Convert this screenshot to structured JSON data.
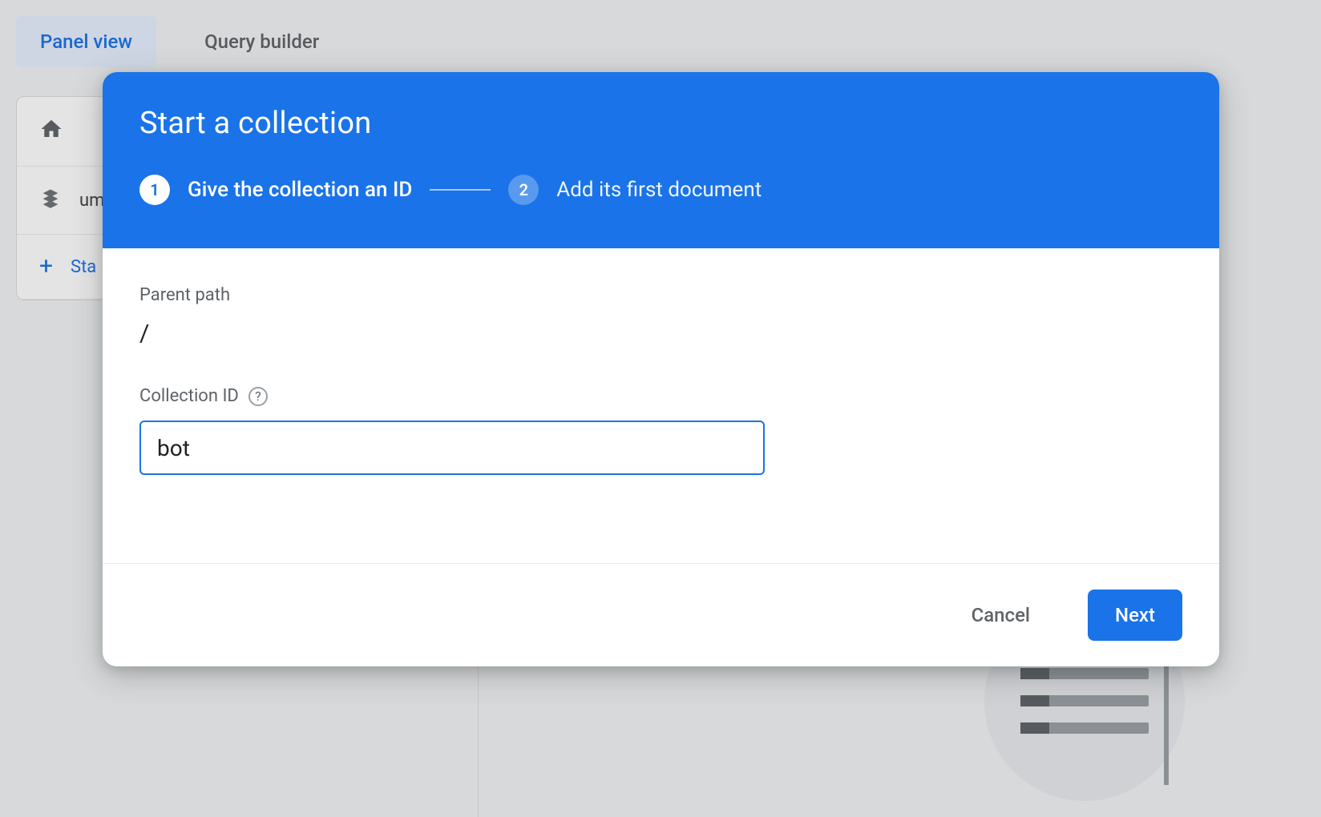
{
  "backdrop": {
    "tabs": {
      "panel_view": "Panel view",
      "query_builder": "Query builder"
    },
    "sidebar": {
      "item_text": "um",
      "start_text": "Sta"
    }
  },
  "modal": {
    "title": "Start a collection",
    "stepper": {
      "step1_num": "1",
      "step1_label": "Give the collection an ID",
      "step2_num": "2",
      "step2_label": "Add its first document"
    },
    "parent_path_label": "Parent path",
    "parent_path_value": "/",
    "collection_id_label": "Collection ID",
    "collection_id_value": "bot",
    "help_char": "?",
    "buttons": {
      "cancel": "Cancel",
      "next": "Next"
    }
  }
}
